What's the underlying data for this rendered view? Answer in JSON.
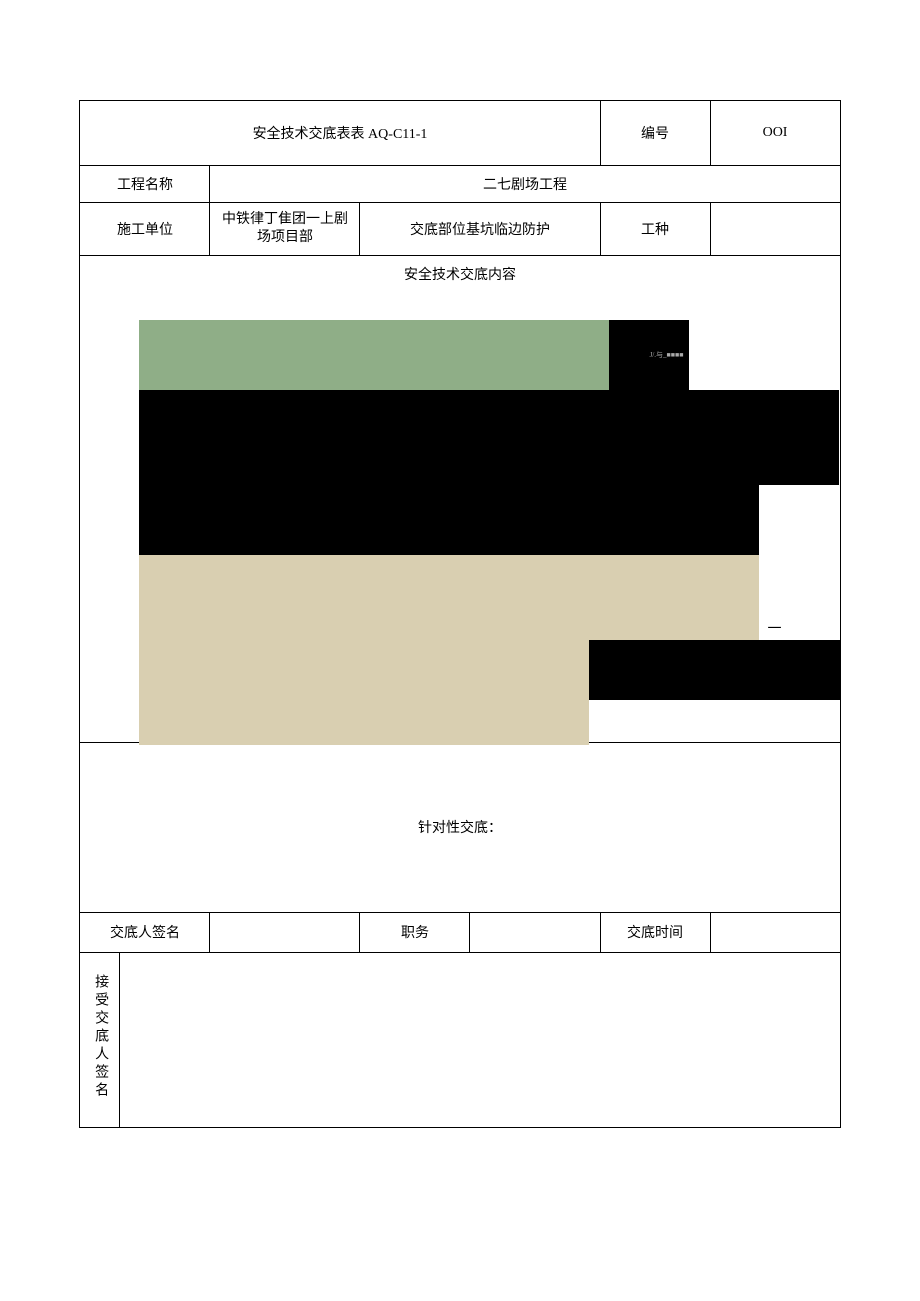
{
  "header": {
    "title": "安全技术交底表表 AQ-C11-1",
    "number_label": "编号",
    "number_value": "OOI"
  },
  "row_project": {
    "label": "工程名称",
    "value": "二七剧场工程"
  },
  "row_unit": {
    "label": "施工单位",
    "unit_line1": "中铁律丁隹团一上剧",
    "unit_line2": "场项目部",
    "part_label_value": "交底部位基坑临边防护",
    "work_type_label": "工种",
    "work_type_value": ""
  },
  "content": {
    "header": "安全技术交底内容",
    "small_text": "J/.与_■■■■",
    "dash": "一"
  },
  "targeted": {
    "label": "针对性交底："
  },
  "signer": {
    "name_label": "交底人签名",
    "name_value": "",
    "position_label": "职务",
    "position_value": "",
    "time_label": "交底时间",
    "time_value": ""
  },
  "receiver": {
    "label": "接受交底人签名",
    "value": ""
  }
}
